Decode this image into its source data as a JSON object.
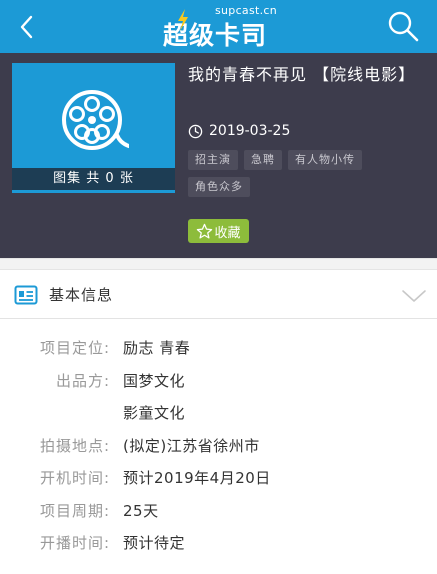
{
  "header": {
    "logo_sub": "supcast.cn",
    "logo_main": "超级卡司",
    "back_icon": "back-arrow-icon",
    "search_icon": "search-icon",
    "bg_color": "#1c9ad6"
  },
  "project": {
    "title": "我的青春不再见 【院线电影】",
    "date": "2019-03-25",
    "gallery_label": "图集 共 0 张",
    "tags": [
      "招主演",
      "急聘",
      "有人物小传",
      "角色众多"
    ],
    "favorite_label": "收藏",
    "poster_icon": "film-reel-icon"
  },
  "basic_info": {
    "title": "基本信息",
    "rows": [
      {
        "label": "项目定位:",
        "value": "励志 青春"
      },
      {
        "label": "出品方:",
        "value": "国梦文化"
      },
      {
        "label": "",
        "value": "影童文化"
      },
      {
        "label": "拍摄地点:",
        "value": "(拟定)江苏省徐州市"
      },
      {
        "label": "开机时间:",
        "value": "预计2019年4月20日"
      },
      {
        "label": "项目周期:",
        "value": "25天"
      },
      {
        "label": "开播时间:",
        "value": "预计待定"
      }
    ]
  }
}
